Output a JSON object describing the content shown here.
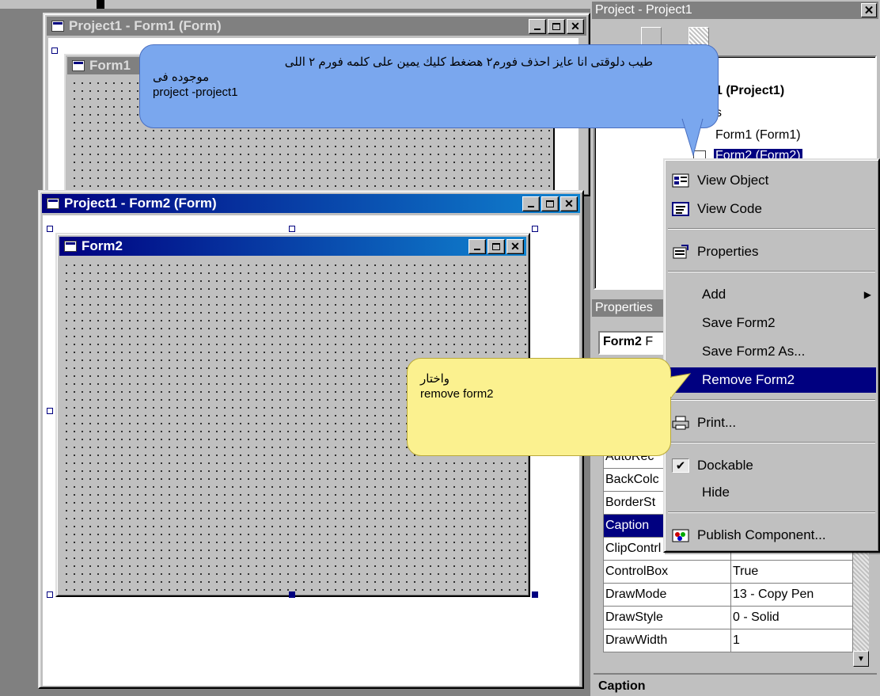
{
  "window1": {
    "title": "Project1 - Form1 (Form)",
    "inner_title": "Form1"
  },
  "window2": {
    "title": "Project1 - Form2 (Form)",
    "inner_title": "Form2"
  },
  "project_explorer": {
    "title": "Project - Project1",
    "close": "✕",
    "root": "1 (Project1)",
    "folder": "s",
    "items": [
      "Form1 (Form1)",
      "Form2 (Form2)"
    ]
  },
  "properties": {
    "title": "Properties",
    "object_prefix": "Form2",
    "object_suffix": "F",
    "rows": [
      {
        "name": "AutoRec",
        "value": ""
      },
      {
        "name": "BackColc",
        "value": ""
      },
      {
        "name": "BorderSt",
        "value": ""
      },
      {
        "name": "Caption",
        "value": ""
      },
      {
        "name": "ClipContrl",
        "value": "True"
      },
      {
        "name": "ControlBox",
        "value": "True"
      },
      {
        "name": "DrawMode",
        "value": "13 - Copy Pen"
      },
      {
        "name": "DrawStyle",
        "value": "0 - Solid"
      },
      {
        "name": "DrawWidth",
        "value": "1"
      }
    ],
    "selected": "Caption",
    "description": "Caption"
  },
  "context_menu": {
    "items": [
      {
        "label": "View Object",
        "icon": "view-object-icon"
      },
      {
        "label": "View Code",
        "icon": "view-code-icon"
      },
      {
        "label": "Properties",
        "icon": "properties-icon"
      },
      {
        "label": "Add",
        "icon": ""
      },
      {
        "label": "Save Form2",
        "icon": ""
      },
      {
        "label": "Save Form2 As...",
        "icon": ""
      },
      {
        "label": "Remove Form2",
        "icon": ""
      },
      {
        "label": "Print...",
        "icon": "printer-icon"
      },
      {
        "label": "Dockable",
        "icon": "checkmark-icon"
      },
      {
        "label": "Hide",
        "icon": ""
      },
      {
        "label": "Publish Component...",
        "icon": "publish-icon"
      }
    ],
    "highlighted": "Remove Form2",
    "submenu_arrow": "▶"
  },
  "callouts": {
    "top": {
      "line1": "طيب دلوقتى انا عايز احذف فورم٢ هضغط كليك يمين على كلمه فورم ٢ اللى",
      "line2": "موجوده فى",
      "line3": "project -project1"
    },
    "bottom": {
      "line1": "واختار",
      "line2": "remove form2"
    }
  },
  "colors": {
    "active_title": "#000080",
    "highlight": "#000080",
    "callout_blue": "#7aa7ee",
    "callout_yellow": "#fbf18f"
  }
}
